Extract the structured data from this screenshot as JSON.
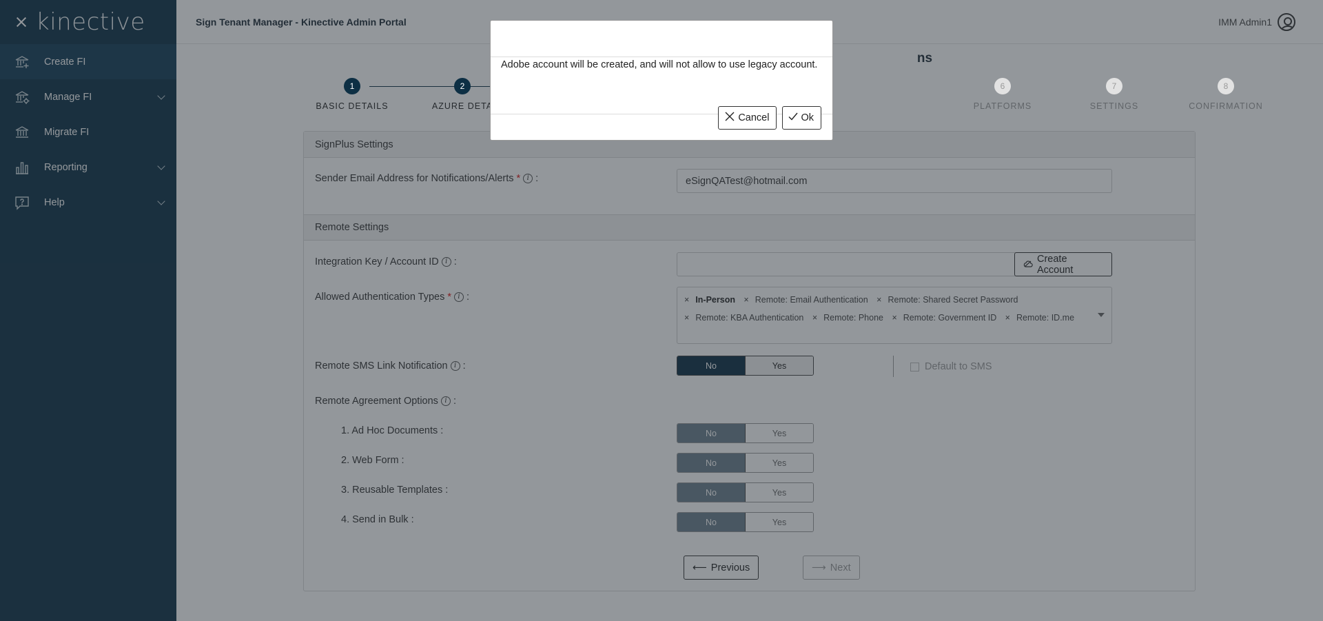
{
  "sidebar": {
    "logo": "kinective",
    "items": [
      {
        "label": "Create FI",
        "icon": "bank-plus-icon",
        "active": true
      },
      {
        "label": "Manage FI",
        "icon": "bank-gear-icon",
        "expandable": true
      },
      {
        "label": "Migrate FI",
        "icon": "bank-icon"
      },
      {
        "label": "Reporting",
        "icon": "bar-chart-icon",
        "expandable": true
      },
      {
        "label": "Help",
        "icon": "help-icon",
        "expandable": true
      }
    ]
  },
  "header": {
    "title": "Sign Tenant Manager - Kinective Admin Portal",
    "user": "IMM Admin1"
  },
  "page": {
    "heading_tail": "ns"
  },
  "stepper": {
    "steps": [
      {
        "num": "1",
        "label": "BASIC DETAILS",
        "state": "done"
      },
      {
        "num": "2",
        "label": "AZURE DETA",
        "state": "done"
      },
      {
        "num": "6",
        "label": "PLATFORMS",
        "state": "inactive"
      },
      {
        "num": "7",
        "label": "SETTINGS",
        "state": "inactive"
      },
      {
        "num": "8",
        "label": "CONFIRMATION",
        "state": "inactive"
      }
    ]
  },
  "signplus": {
    "title": "SignPlus Settings",
    "sender_label": "Sender Email Address for Notifications/Alerts",
    "sender_value": "eSignQATest@hotmail.com"
  },
  "remote": {
    "title": "Remote Settings",
    "integration_label": "Integration Key / Account ID",
    "integration_value": "",
    "create_account": "Create Account",
    "auth_label": "Allowed Authentication Types",
    "auth_types": [
      "In-Person",
      "Remote: Email Authentication",
      "Remote: Shared Secret Password",
      "Remote: KBA Authentication",
      "Remote: Phone",
      "Remote: Government ID",
      "Remote: ID.me"
    ],
    "sms_label": "Remote SMS Link Notification",
    "default_sms": "Default to SMS",
    "agreement_label": "Remote Agreement Options",
    "options": [
      "1. Ad Hoc Documents :",
      "2. Web Form :",
      "3. Reusable Templates :",
      "4. Send in Bulk :"
    ],
    "no": "No",
    "yes": "Yes"
  },
  "nav": {
    "previous": "Previous",
    "next": "Next"
  },
  "modal": {
    "message": "Adobe account will be created, and will not allow to use legacy account.",
    "cancel": "Cancel",
    "ok": "Ok"
  },
  "colors": {
    "sidebar": "#0d3146",
    "primary": "#0d2f44",
    "required": "#d11111"
  }
}
